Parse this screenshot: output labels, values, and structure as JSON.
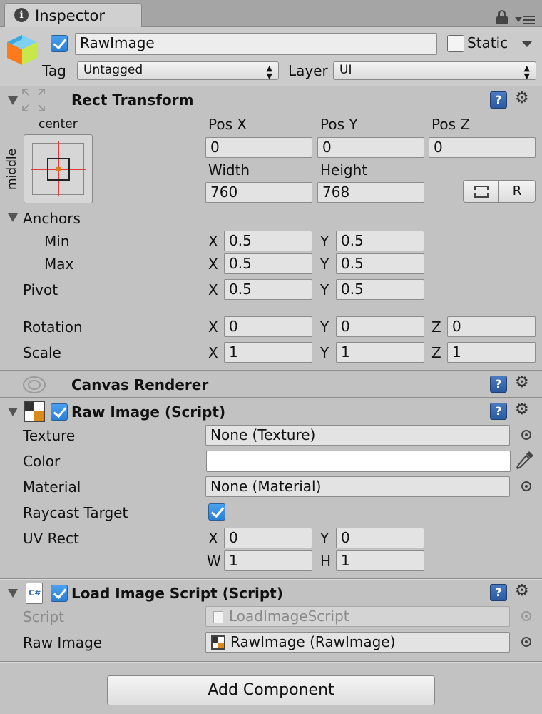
{
  "tab": {
    "title": "Inspector"
  },
  "gameobject": {
    "name": "RawImage",
    "active": true,
    "static_label": "Static",
    "static_checked": false,
    "tag_label": "Tag",
    "tag_value": "Untagged",
    "layer_label": "Layer",
    "layer_value": "UI"
  },
  "rect_transform": {
    "title": "Rect Transform",
    "anchor_preset_top": "center",
    "anchor_preset_side": "middle",
    "pos_x_label": "Pos X",
    "pos_y_label": "Pos Y",
    "pos_z_label": "Pos Z",
    "pos_x": "0",
    "pos_y": "0",
    "pos_z": "0",
    "width_label": "Width",
    "height_label": "Height",
    "width": "760",
    "height": "768",
    "raw_button": "R",
    "anchors_label": "Anchors",
    "min_label": "Min",
    "max_label": "Max",
    "min_x": "0.5",
    "min_y": "0.5",
    "max_x": "0.5",
    "max_y": "0.5",
    "pivot_label": "Pivot",
    "pivot_x": "0.5",
    "pivot_y": "0.5",
    "rotation_label": "Rotation",
    "rot_x": "0",
    "rot_y": "0",
    "rot_z": "0",
    "scale_label": "Scale",
    "scale_x": "1",
    "scale_y": "1",
    "scale_z": "1",
    "axis_x": "X",
    "axis_y": "Y",
    "axis_z": "Z"
  },
  "canvas_renderer": {
    "title": "Canvas Renderer"
  },
  "raw_image": {
    "title": "Raw Image (Script)",
    "enabled": true,
    "texture_label": "Texture",
    "texture_value": "None (Texture)",
    "color_label": "Color",
    "color_value": "#ffffff",
    "material_label": "Material",
    "material_value": "None (Material)",
    "raycast_label": "Raycast Target",
    "raycast_checked": true,
    "uvrect_label": "UV Rect",
    "uv_x": "0",
    "uv_y": "0",
    "uv_w": "1",
    "uv_h": "1",
    "axis_w": "W",
    "axis_h": "H"
  },
  "load_image_script": {
    "title": "Load Image Script (Script)",
    "enabled": true,
    "script_label": "Script",
    "script_value": "LoadImageScript",
    "raw_image_label": "Raw Image",
    "raw_image_value": "RawImage (RawImage)"
  },
  "add_component": {
    "label": "Add Component"
  },
  "icons": [
    "info-icon",
    "lock-icon",
    "menu-icon",
    "cube-icon",
    "dropdown-arrow-icon",
    "rect-transform-icon",
    "help-icon",
    "gear-icon",
    "canvas-renderer-icon",
    "raw-image-icon",
    "script-icon",
    "object-picker-icon",
    "eyedropper-icon",
    "blueprint-mode-icon"
  ]
}
